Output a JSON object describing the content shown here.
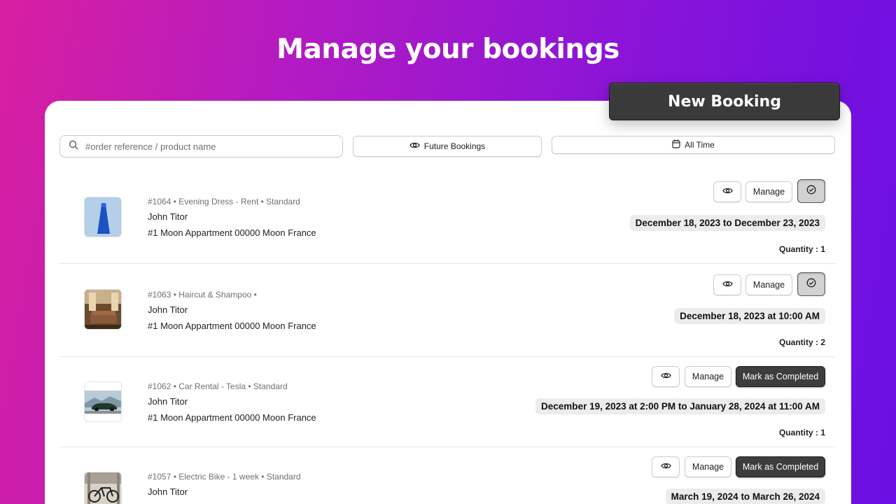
{
  "headline": "Manage your bookings",
  "new_booking_label": "New Booking",
  "search": {
    "placeholder": "#order reference / product name"
  },
  "filters": {
    "future": "Future Bookings",
    "time": "All Time"
  },
  "bookings": [
    {
      "meta": "#1064 • Evening Dress - Rent • Standard",
      "customer": "John Titor",
      "address": "#1 Moon Appartment 00000 Moon France",
      "manage_label": "Manage",
      "date": "December 18, 2023 to December 23, 2023",
      "quantity": "Quantity : 1",
      "thumb": "evening-dress-thumbnail"
    },
    {
      "meta": "#1063 • Haircut & Shampoo •",
      "customer": "John Titor",
      "address": "#1 Moon Appartment 00000 Moon France",
      "manage_label": "Manage",
      "date": "December 18, 2023 at 10:00 AM",
      "quantity": "Quantity : 2",
      "thumb": "salon-thumbnail"
    },
    {
      "meta": "#1062 • Car Rental - Tesla • Standard",
      "customer": "John Titor",
      "address": "#1 Moon Appartment 00000 Moon France",
      "manage_label": "Manage",
      "complete_label": "Mark as Completed",
      "date": "December 19, 2023 at 2:00 PM to January 28, 2024 at 11:00 AM",
      "quantity": "Quantity : 1",
      "thumb": "tesla-car-thumbnail"
    },
    {
      "meta": "#1057 • Electric Bike - 1 week • Standard",
      "customer": "John Titor",
      "manage_label": "Manage",
      "complete_label": "Mark as Completed",
      "date": "March 19, 2024 to March 26, 2024",
      "thumb": "electric-bike-thumbnail"
    }
  ],
  "colors": {
    "gradient_start": "#d81fa0",
    "gradient_end": "#6a0fe4",
    "dark_button": "#3d3d3d",
    "date_pill": "#ececec"
  }
}
